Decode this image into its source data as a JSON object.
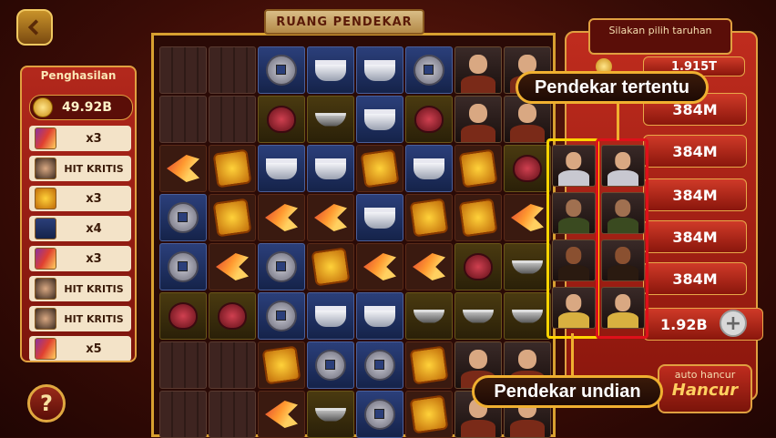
{
  "board_title": "RUANG PENDEKAR",
  "left_panel": {
    "title": "Penghasilan",
    "total": "49.92B",
    "history": [
      {
        "icon": "axe-icon",
        "label": "x3"
      },
      {
        "icon": "warrior-portrait-icon",
        "label": "HIT KRITIS"
      },
      {
        "icon": "seal-icon",
        "label": "x3"
      },
      {
        "icon": "ingot-icon",
        "label": "x4"
      },
      {
        "icon": "axe-icon",
        "label": "x3"
      },
      {
        "icon": "warrior-portrait-icon",
        "label": "HIT KRITIS"
      },
      {
        "icon": "warrior-portrait-icon",
        "label": "HIT KRITIS"
      },
      {
        "icon": "axe-icon",
        "label": "x5"
      }
    ]
  },
  "right_panel": {
    "title": "Silakan pilih taruhan",
    "top_bet": "1.915T",
    "bets": [
      "384M",
      "384M",
      "384M",
      "384M",
      "384M",
      "1.92B"
    ],
    "auto_label": "auto hancur",
    "auto_button": "Hancur"
  },
  "callouts": {
    "specific": "Pendekar tertentu",
    "draw": "Pendekar undian"
  },
  "help_label": "?",
  "plus_label": "+",
  "colors": {
    "highlight_yellow": "#ffd400",
    "highlight_red": "#e0101a",
    "callout_border": "#f0b030"
  }
}
